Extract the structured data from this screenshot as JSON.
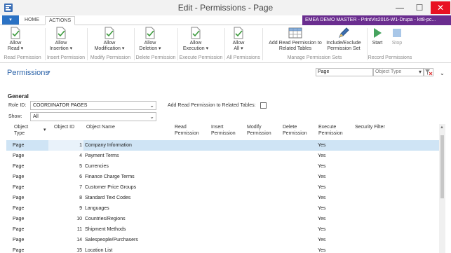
{
  "window": {
    "title": "Edit - Permissions - Page",
    "minimize": "—",
    "maximize": "☐",
    "close": "✕"
  },
  "ribbon_tabs": {
    "file": "▾",
    "home": "HOME",
    "actions": "ACTIONS",
    "company": "EMEA DEMO MASTER - PrintVis2016-W1-Drupa - kit8-pc..."
  },
  "ribbon": {
    "buttons": [
      {
        "label1": "Allow",
        "label2": "Read ▾"
      },
      {
        "label1": "Allow",
        "label2": "Insertion ▾"
      },
      {
        "label1": "Allow",
        "label2": "Modification ▾"
      },
      {
        "label1": "Allow",
        "label2": "Deletion ▾"
      },
      {
        "label1": "Allow",
        "label2": "Execution ▾"
      },
      {
        "label1": "Allow",
        "label2": "All ▾"
      },
      {
        "label1": "Add Read Permission to",
        "label2": "Related Tables"
      },
      {
        "label1": "Include/Exclude",
        "label2": "Permission Set"
      },
      {
        "label1": "Start",
        "label2": ""
      },
      {
        "label1": "Stop",
        "label2": ""
      }
    ],
    "groups": [
      "Read Permission",
      "Insert Permission",
      "Modify Permission",
      "Delete Permission",
      "Execute Permission",
      "All Permissions",
      "Manage Permission Sets",
      "Record Permissions"
    ]
  },
  "page": {
    "title": "Permissions",
    "title_caret": "▾",
    "filter_value": "Page",
    "filter_field": "Object Type",
    "collapse": "⌄"
  },
  "general": {
    "heading": "General",
    "role_label": "Role ID:",
    "role_value": "COORDINATOR PAGES",
    "show_label": "Show:",
    "show_value": "All",
    "related_label": "Add Read Permission to Related Tables:"
  },
  "table": {
    "headers": [
      {
        "l1": "Object",
        "l2": "Type"
      },
      {
        "l1": "Object ID",
        "l2": ""
      },
      {
        "l1": "Object Name",
        "l2": ""
      },
      {
        "l1": "Read",
        "l2": "Permission"
      },
      {
        "l1": "Insert",
        "l2": "Permission"
      },
      {
        "l1": "Modify",
        "l2": "Permission"
      },
      {
        "l1": "Delete",
        "l2": "Permission"
      },
      {
        "l1": "Execute",
        "l2": "Permission"
      },
      {
        "l1": "Security Filter",
        "l2": ""
      }
    ],
    "sort_indicator": "▾",
    "rows": [
      {
        "type": "Page",
        "id": "1",
        "name": "Company Information",
        "exec": "Yes"
      },
      {
        "type": "Page",
        "id": "4",
        "name": "Payment Terms",
        "exec": "Yes"
      },
      {
        "type": "Page",
        "id": "5",
        "name": "Currencies",
        "exec": "Yes"
      },
      {
        "type": "Page",
        "id": "6",
        "name": "Finance Charge Terms",
        "exec": "Yes"
      },
      {
        "type": "Page",
        "id": "7",
        "name": "Customer Price Groups",
        "exec": "Yes"
      },
      {
        "type": "Page",
        "id": "8",
        "name": "Standard Text Codes",
        "exec": "Yes"
      },
      {
        "type": "Page",
        "id": "9",
        "name": "Languages",
        "exec": "Yes"
      },
      {
        "type": "Page",
        "id": "10",
        "name": "Countries/Regions",
        "exec": "Yes"
      },
      {
        "type": "Page",
        "id": "11",
        "name": "Shipment Methods",
        "exec": "Yes"
      },
      {
        "type": "Page",
        "id": "14",
        "name": "Salespeople/Purchasers",
        "exec": "Yes"
      },
      {
        "type": "Page",
        "id": "15",
        "name": "Location List",
        "exec": "Yes"
      }
    ]
  },
  "colors": {
    "accent": "#2a62a8",
    "file_tab": "#2b72c4",
    "company_bar": "#6a2d8f",
    "selected_row": "#cfe4f5",
    "close_button": "#e81123"
  }
}
